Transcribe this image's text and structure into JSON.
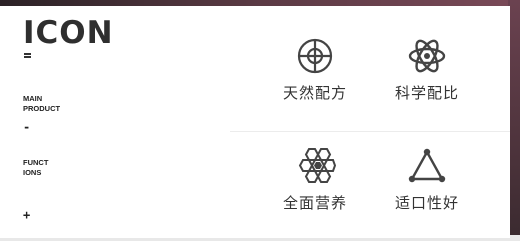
{
  "brand": {
    "logo": "ICON"
  },
  "sidebar": {
    "sections": [
      {
        "label_line1": "MAIN",
        "label_line2": "PRODUCT",
        "toggle": "-"
      },
      {
        "label_line1": "FUNCT",
        "label_line2": "IONS",
        "toggle": "+"
      }
    ]
  },
  "features": [
    {
      "label": "天然配方",
      "icon": "target-crosshair-icon"
    },
    {
      "label": "科学配比",
      "icon": "atom-icon"
    },
    {
      "label": "全面营养",
      "icon": "hexagon-cluster-icon"
    },
    {
      "label": "适口性好",
      "icon": "triangle-nodes-icon"
    }
  ]
}
